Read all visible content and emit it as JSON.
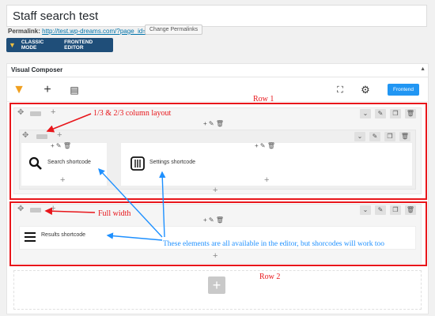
{
  "post": {
    "title": "Staff search test",
    "permalink_label": "Permalink:",
    "permalink_url": "http://test.wp-dreams.com/?page_id=342",
    "change_permalinks": "Change Permalinks"
  },
  "mode_bar": {
    "classic": "CLASSIC MODE",
    "frontend": "FRONTEND EDITOR"
  },
  "vc": {
    "header": "Visual Composer",
    "frontend_button": "Frontend"
  },
  "rows": [
    {
      "columns": [
        {
          "shortcode": "Search shortcode",
          "icon": "search-icon"
        },
        {
          "shortcode": "Settings shortcode",
          "icon": "settings-sliders-icon"
        }
      ]
    },
    {
      "columns": [
        {
          "shortcode": "Results shortcode",
          "icon": "list-icon"
        }
      ]
    }
  ],
  "annotations": {
    "row1": "Row 1",
    "row2": "Row 2",
    "column_layout": "1/3 & 2/3 column layout",
    "full_width": "Full width",
    "elements_note": "These elements are all available in the editor, but shorcodes will work too"
  },
  "colors": {
    "annotation_red": "#e8161b",
    "annotation_blue": "#1e90ff",
    "frontend_button": "#2196f3",
    "mode_bar": "#1f4e79"
  }
}
